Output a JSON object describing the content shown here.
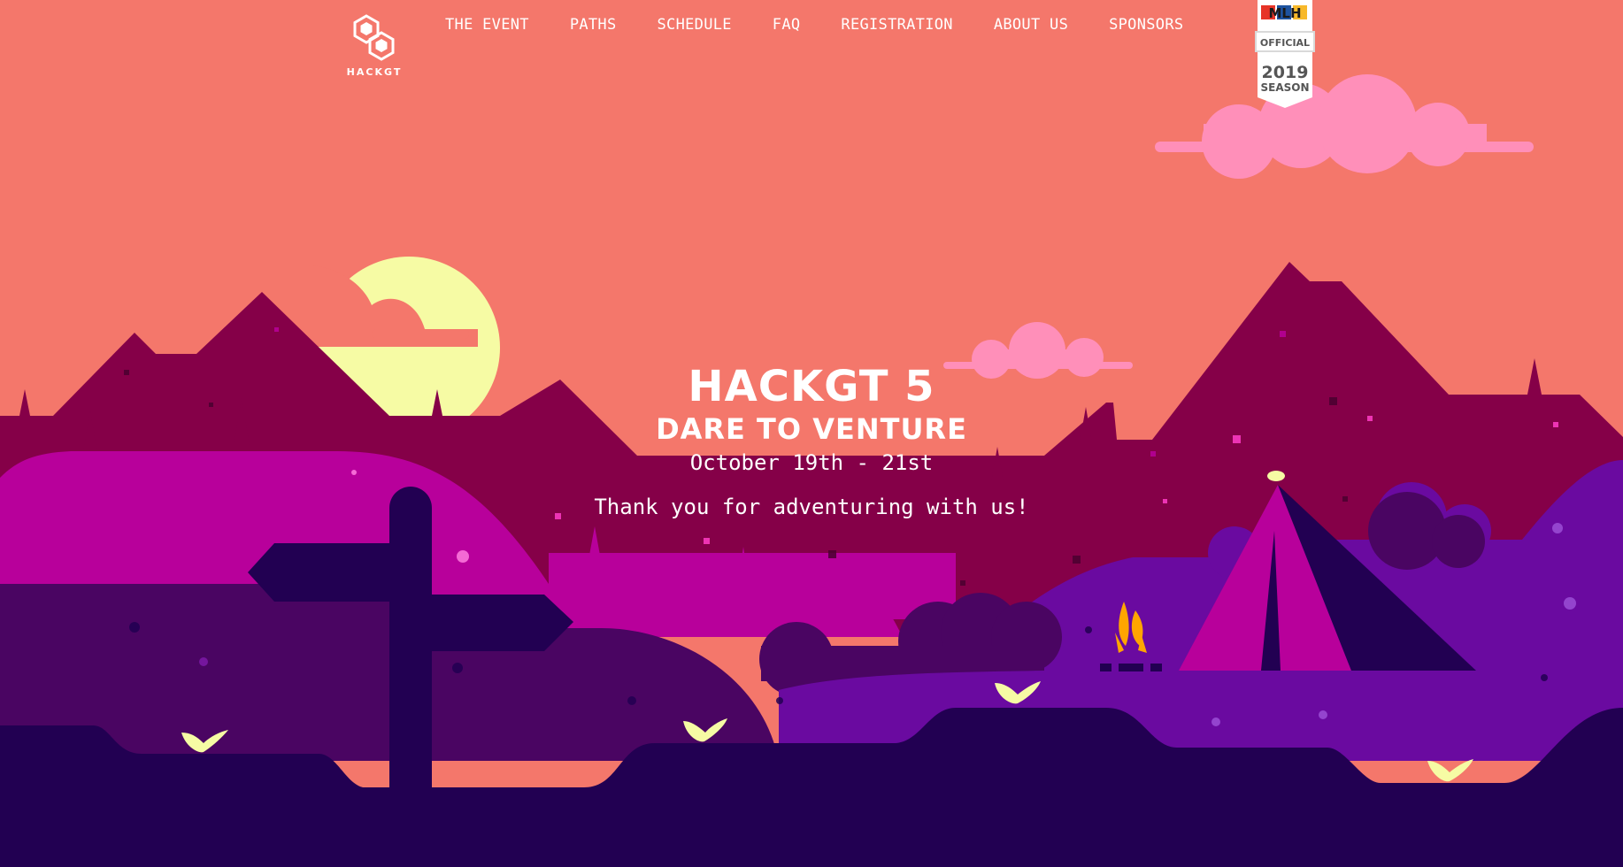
{
  "logo": {
    "text": "HACKGT",
    "icon": "hexagon-pair-logo"
  },
  "nav": {
    "items": [
      {
        "label": "THE EVENT"
      },
      {
        "label": "PATHS"
      },
      {
        "label": "SCHEDULE"
      },
      {
        "label": "FAQ"
      },
      {
        "label": "REGISTRATION"
      },
      {
        "label": "ABOUT US"
      },
      {
        "label": "SPONSORS"
      }
    ]
  },
  "mlh_badge": {
    "brand": "MLH",
    "line1": "OFFICIAL",
    "line2": "2019",
    "line3": "SEASON"
  },
  "hero": {
    "title": "HACKGT 5",
    "subtitle": "DARE TO VENTURE",
    "dates": "October 19th - 21st",
    "message": "Thank you for adventuring with us!"
  },
  "colors": {
    "sky": "#f4776b",
    "sun": "#f6fba4",
    "cloud": "#ff8fb9",
    "mountain_far": "#850048",
    "hill_magenta": "#b8009b",
    "hill_purple": "#4a0562",
    "hill_violet": "#6a0aa0",
    "ground_dark": "#220052",
    "sprout": "#f6fba4",
    "fire": "#ffa500"
  }
}
